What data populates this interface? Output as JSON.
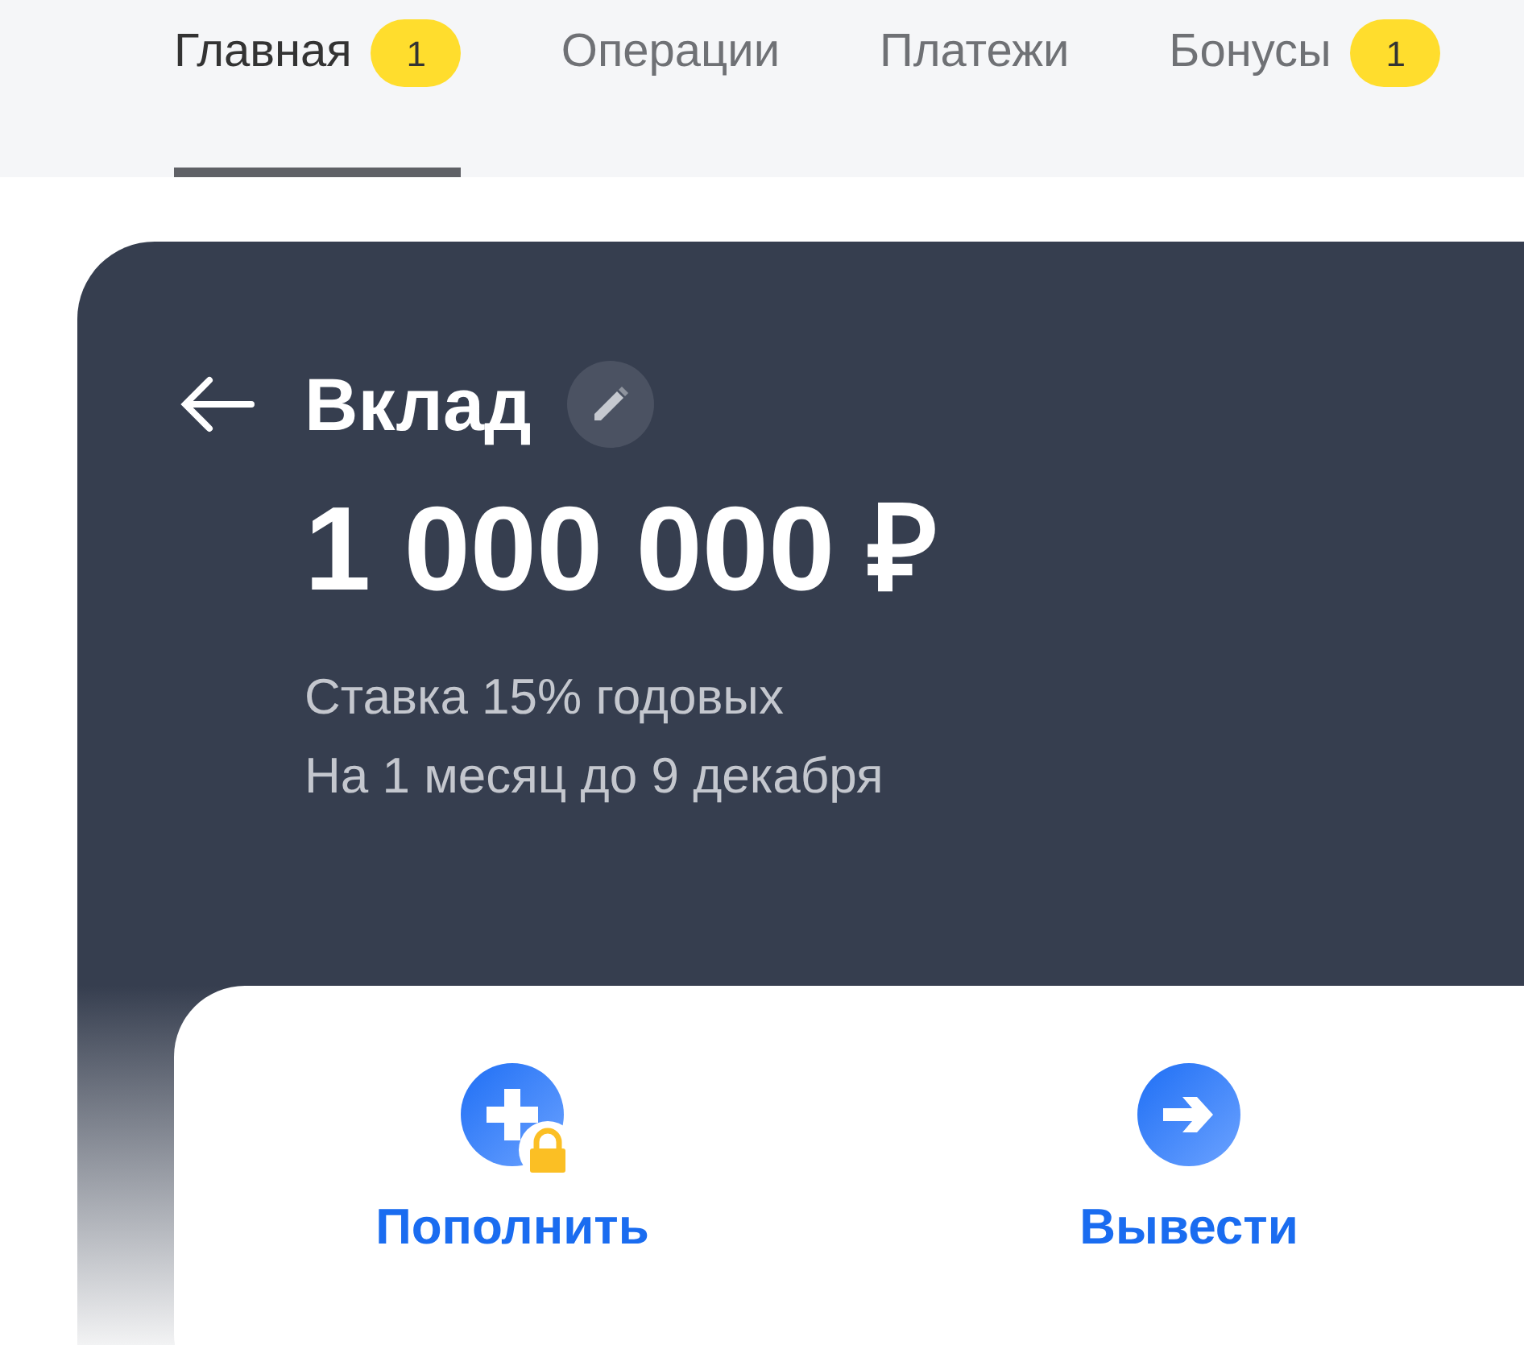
{
  "tabs": [
    {
      "label": "Главная",
      "selected": true,
      "badge": "1"
    },
    {
      "label": "Операции",
      "selected": false
    },
    {
      "label": "Платежи",
      "selected": false
    },
    {
      "label": "Бонусы",
      "selected": false,
      "badge": "1"
    }
  ],
  "deposit": {
    "title": "Вклад",
    "amount": "1 000 000 ₽",
    "details": [
      "Ставка 15% годовых",
      "На 1 месяц до 9 декабря"
    ]
  },
  "actions": [
    {
      "label": "Пополнить",
      "kind": "add",
      "locked": true
    },
    {
      "label": "Вывести",
      "kind": "withdraw",
      "locked": false
    }
  ]
}
